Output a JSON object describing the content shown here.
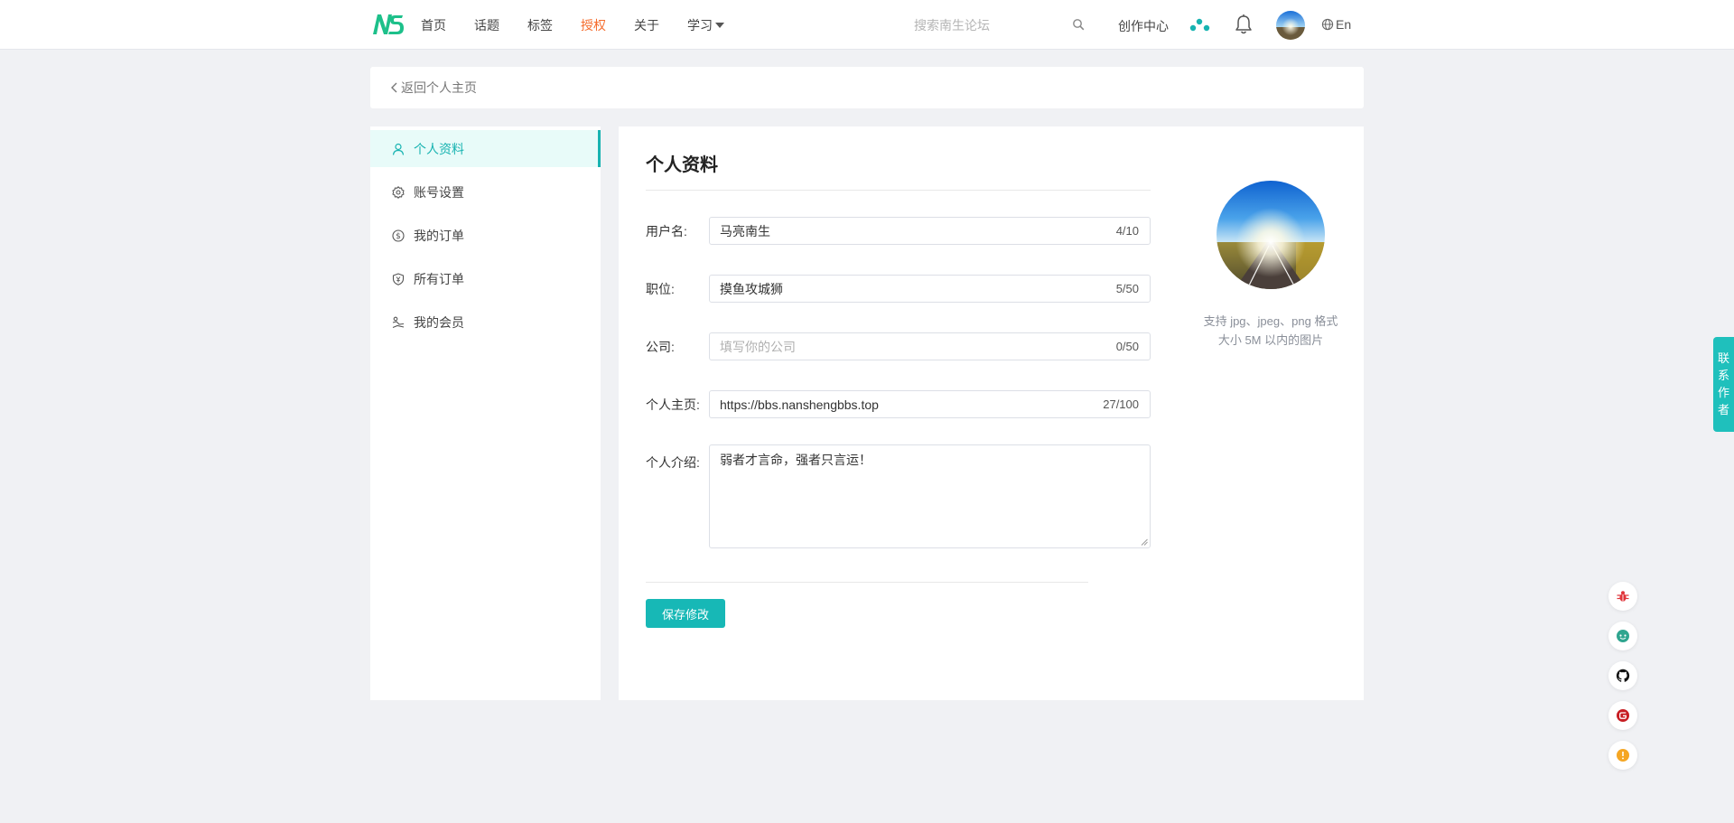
{
  "header": {
    "logo_alt": "NS",
    "nav": [
      {
        "label": "首页"
      },
      {
        "label": "话题"
      },
      {
        "label": "标签"
      },
      {
        "label": "授权"
      },
      {
        "label": "关于"
      },
      {
        "label": "学习"
      }
    ],
    "search_placeholder": "搜索南生论坛",
    "creator_label": "创作中心",
    "lang_label": "En"
  },
  "back": {
    "label": "返回个人主页"
  },
  "sidebar": {
    "items": [
      {
        "label": "个人资料",
        "icon": "user-icon",
        "active": true
      },
      {
        "label": "账号设置",
        "icon": "gear-icon"
      },
      {
        "label": "我的订单",
        "icon": "dollar-circle-icon"
      },
      {
        "label": "所有订单",
        "icon": "shield-yen-icon"
      },
      {
        "label": "我的会员",
        "icon": "member-icon"
      }
    ]
  },
  "profile": {
    "title": "个人资料",
    "fields": {
      "username": {
        "label": "用户名",
        "value": "马亮南生",
        "count": "4/10"
      },
      "position": {
        "label": "职位",
        "value": "摸鱼攻城狮",
        "count": "5/50"
      },
      "company": {
        "label": "公司",
        "value": "",
        "placeholder": "填写你的公司",
        "count": "0/50"
      },
      "homepage": {
        "label": "个人主页",
        "value": "https://bbs.nanshengbbs.top",
        "count": "27/100"
      },
      "bio": {
        "label": "个人介绍",
        "value": "弱者才言命，强者只言运！"
      }
    },
    "save_label": "保存修改",
    "avatar_hint_line1": "支持 jpg、jpeg、png 格式",
    "avatar_hint_line2": "大小 5M 以内的图片"
  },
  "float": {
    "contact_chars": [
      "联",
      "系",
      "作",
      "者"
    ],
    "buttons": [
      {
        "icon": "bug-icon",
        "color": "#e0343a"
      },
      {
        "icon": "chat-icon",
        "color": "#2fa58f"
      },
      {
        "icon": "github-icon",
        "color": "#111111"
      },
      {
        "icon": "gitee-icon",
        "color": "#c71d23"
      },
      {
        "icon": "alert-icon",
        "color": "#f5a623"
      }
    ]
  },
  "colors": {
    "accent": "#17b3b1",
    "auth": "#f56c2d",
    "background": "#f0f1f4"
  }
}
